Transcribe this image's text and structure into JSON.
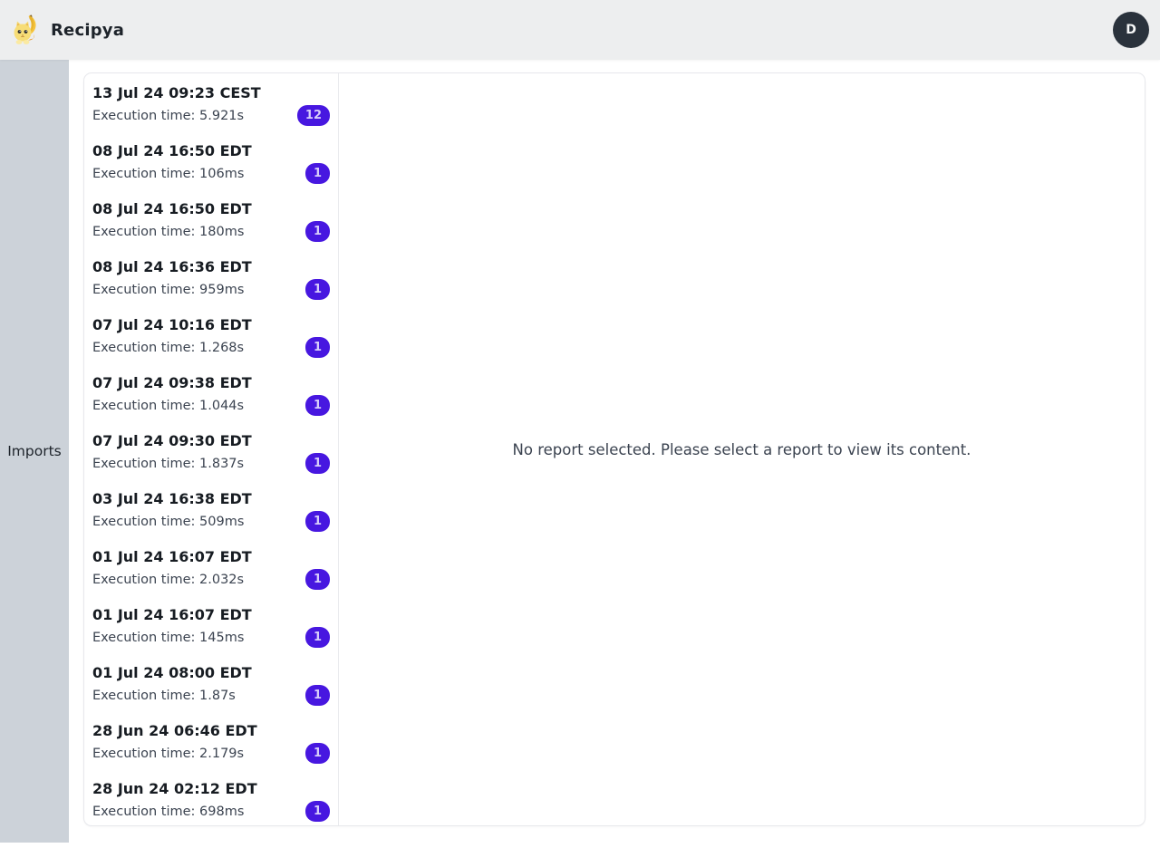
{
  "header": {
    "app_title": "Recipya",
    "avatar_initial": "D"
  },
  "sidebar": {
    "items": [
      {
        "label": "Imports"
      }
    ]
  },
  "reports": {
    "empty_message": "No report selected. Please select a report to view its content.",
    "items": [
      {
        "title": "13 Jul 24 09:23 CEST",
        "subtitle": "Execution time: 5.921s",
        "count": "12"
      },
      {
        "title": "08 Jul 24 16:50 EDT",
        "subtitle": "Execution time: 106ms",
        "count": "1"
      },
      {
        "title": "08 Jul 24 16:50 EDT",
        "subtitle": "Execution time: 180ms",
        "count": "1"
      },
      {
        "title": "08 Jul 24 16:36 EDT",
        "subtitle": "Execution time: 959ms",
        "count": "1"
      },
      {
        "title": "07 Jul 24 10:16 EDT",
        "subtitle": "Execution time: 1.268s",
        "count": "1"
      },
      {
        "title": "07 Jul 24 09:38 EDT",
        "subtitle": "Execution time: 1.044s",
        "count": "1"
      },
      {
        "title": "07 Jul 24 09:30 EDT",
        "subtitle": "Execution time: 1.837s",
        "count": "1"
      },
      {
        "title": "03 Jul 24 16:38 EDT",
        "subtitle": "Execution time: 509ms",
        "count": "1"
      },
      {
        "title": "01 Jul 24 16:07 EDT",
        "subtitle": "Execution time: 2.032s",
        "count": "1"
      },
      {
        "title": "01 Jul 24 16:07 EDT",
        "subtitle": "Execution time: 145ms",
        "count": "1"
      },
      {
        "title": "01 Jul 24 08:00 EDT",
        "subtitle": "Execution time: 1.87s",
        "count": "1"
      },
      {
        "title": "28 Jun 24 06:46 EDT",
        "subtitle": "Execution time: 2.179s",
        "count": "1"
      },
      {
        "title": "28 Jun 24 02:12 EDT",
        "subtitle": "Execution time: 698ms",
        "count": "1"
      }
    ]
  },
  "colors": {
    "badge_bg": "#4717e0",
    "badge_text": "#d7cdfa",
    "avatar_bg": "#2a323c",
    "sidebar_bg": "#ccd2d9",
    "header_bg": "#edeeef"
  }
}
